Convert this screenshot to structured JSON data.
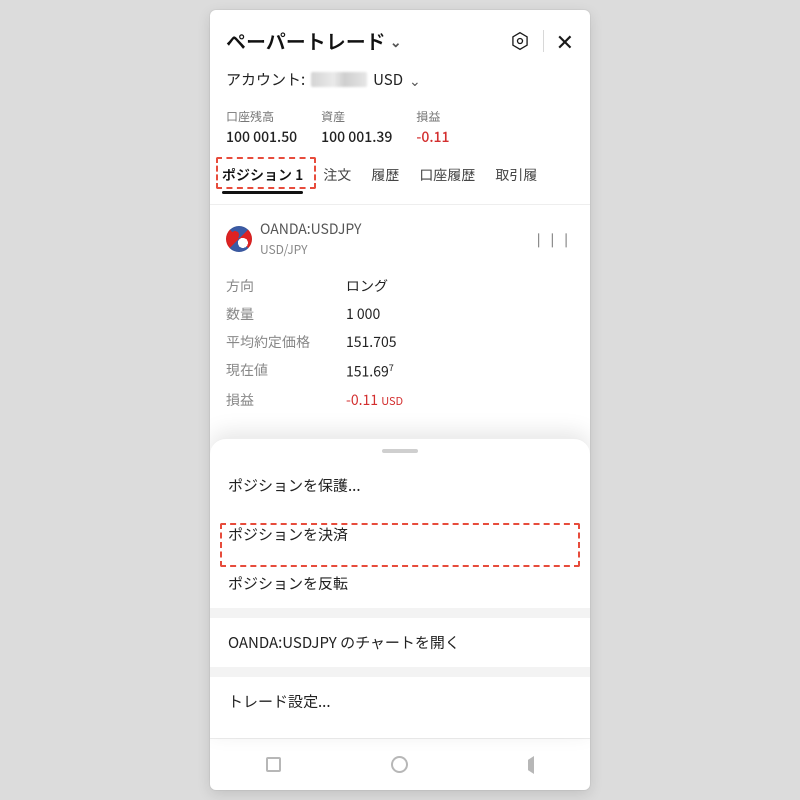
{
  "header": {
    "title": "ペーパートレード",
    "settings_icon": "settings-hexagon",
    "close_icon": "close-x"
  },
  "account": {
    "label": "アカウント:",
    "currency": "USD"
  },
  "stats": {
    "balance": {
      "label": "口座残高",
      "value": "100 001.50"
    },
    "equity": {
      "label": "資産",
      "value": "100 001.39"
    },
    "pnl": {
      "label": "損益",
      "value": "-0.11"
    }
  },
  "tabs": [
    {
      "id": "positions",
      "label": "ポジション 1",
      "active": true
    },
    {
      "id": "orders",
      "label": "注文"
    },
    {
      "id": "history",
      "label": "履歴"
    },
    {
      "id": "acct-history",
      "label": "口座履歴"
    },
    {
      "id": "trade-history",
      "label": "取引履"
    }
  ],
  "position": {
    "symbol": "OANDA:USDJPY",
    "pair": "USD/JPY",
    "rows": {
      "side": {
        "label": "方向",
        "value": "ロング"
      },
      "qty": {
        "label": "数量",
        "value": "1 000"
      },
      "avg": {
        "label": "平均約定価格",
        "value": "151.705"
      },
      "price": {
        "label": "現在値",
        "value": "151.69",
        "sup": "7"
      },
      "pnl": {
        "label": "損益",
        "value": "-0.11",
        "unit": "USD"
      }
    }
  },
  "sheet": {
    "protect": "ポジションを保護...",
    "close": "ポジションを決済",
    "reverse": "ポジションを反転",
    "open_chart": "OANDA:USDJPY のチャートを開く",
    "trade_settings": "トレード設定..."
  },
  "colors": {
    "negative": "#d32f2f",
    "link": "#1565d8",
    "highlight": "#e74c3c"
  }
}
